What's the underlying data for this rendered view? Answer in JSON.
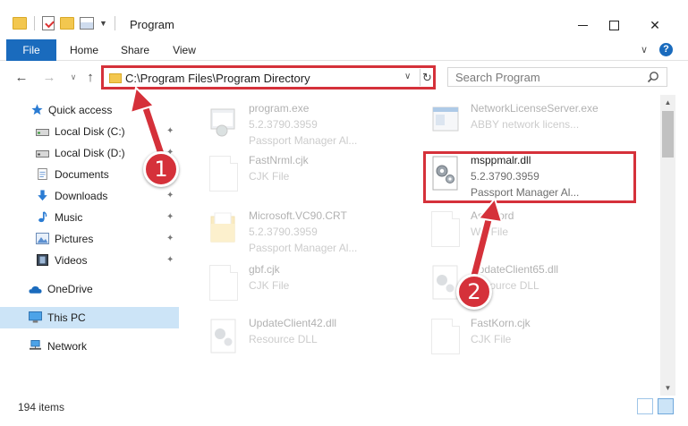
{
  "window": {
    "title": "Program",
    "minimize_icon": "minimize-icon",
    "maximize_icon": "maximize-icon",
    "close_glyph": "✕"
  },
  "ribbon": {
    "tabs": [
      "File",
      "Home",
      "Share",
      "View"
    ],
    "expand_glyph": "∨",
    "help_glyph": "?"
  },
  "nav": {
    "back_glyph": "←",
    "forward_glyph": "→",
    "recent_glyph": "∨",
    "up_glyph": "↑",
    "address": "C:\\Program Files\\Program Directory",
    "address_dropdown_glyph": "∨",
    "refresh_glyph": "↻",
    "search_placeholder": "Search Program"
  },
  "sidebar": {
    "items": [
      {
        "label": "Quick access",
        "icon": "star-icon"
      },
      {
        "label": "Local Disk (C:)",
        "icon": "drive-icon",
        "pinned": true
      },
      {
        "label": "Local Disk (D:)",
        "icon": "drive-icon",
        "pinned": true
      },
      {
        "label": "Documents",
        "icon": "documents-icon",
        "pinned": true
      },
      {
        "label": "Downloads",
        "icon": "download-icon",
        "pinned": true
      },
      {
        "label": "Music",
        "icon": "music-icon",
        "pinned": true
      },
      {
        "label": "Pictures",
        "icon": "pictures-icon",
        "pinned": true
      },
      {
        "label": "Videos",
        "icon": "videos-icon",
        "pinned": true
      },
      {
        "label": "OneDrive",
        "icon": "cloud-icon"
      },
      {
        "label": "This PC",
        "icon": "computer-icon",
        "selected": true
      },
      {
        "label": "Network",
        "icon": "network-icon"
      }
    ],
    "pin_glyph": "📌"
  },
  "files": [
    {
      "name": "program.exe",
      "line2": "5.2.3790.3959",
      "line3": "Passport Manager Al...",
      "icon": "exe-icon"
    },
    {
      "name": "NetworkLicenseServer.exe",
      "line2": "ABBY network licens...",
      "line3": "",
      "icon": "exe-icon"
    },
    {
      "name": "FastNrml.cjk",
      "line2": "CJK File",
      "line3": "",
      "icon": "file-icon"
    },
    {
      "name": "msppmalr.dll",
      "line2": "5.2.3790.3959",
      "line3": "Passport Manager Al...",
      "icon": "dll-gear-icon",
      "focus": true
    },
    {
      "name": "Microsoft.VC90.CRT",
      "line2": "5.2.3790.3959",
      "line3": "Passport Manager Al...",
      "icon": "folder-icon"
    },
    {
      "name": "AskWord",
      "line2": "WE File",
      "line3": "",
      "icon": "file-icon"
    },
    {
      "name": "gbf.cjk",
      "line2": "CJK File",
      "line3": "",
      "icon": "file-icon"
    },
    {
      "name": "UpdateClient65.dll",
      "line2": "Resource DLL",
      "line3": "",
      "icon": "dll-gear-icon"
    },
    {
      "name": "UpdateClient42.dll",
      "line2": "Resource DLL",
      "line3": "",
      "icon": "dll-gear-icon"
    },
    {
      "name": "FastKorn.cjk",
      "line2": "CJK File",
      "line3": "",
      "icon": "file-icon"
    }
  ],
  "status": {
    "item_count": "194 items"
  },
  "callouts": [
    "1",
    "2"
  ],
  "colors": {
    "accent": "#1a6bbd",
    "highlight": "#d5313a",
    "selection": "#cce4f7"
  }
}
